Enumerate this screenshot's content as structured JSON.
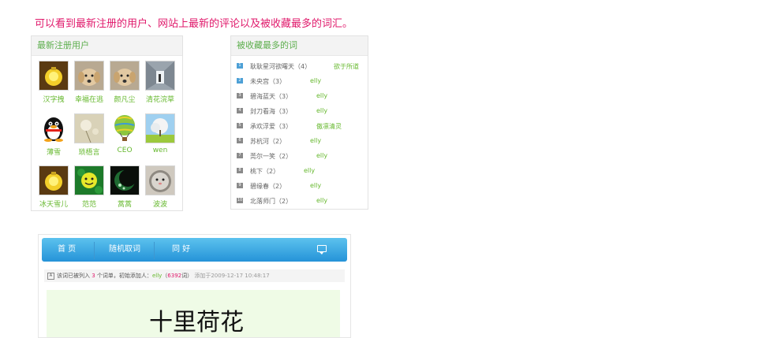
{
  "headline": "可以看到最新注册的用户、网站上最新的评论以及被收藏最多的词汇。",
  "users_panel": {
    "title": "最新注册用户",
    "users": [
      {
        "name": "汉字拽",
        "avatar": "glowing-ball-icon"
      },
      {
        "name": "幸福在逃",
        "avatar": "puppy-icon"
      },
      {
        "name": "颜凡尘",
        "avatar": "puppy-icon"
      },
      {
        "name": "清花浣草",
        "avatar": "corridor-icon"
      },
      {
        "name": "薄雪",
        "avatar": "penguin-icon"
      },
      {
        "name": "琐梧言",
        "avatar": "dandelion-icon"
      },
      {
        "name": "CEO",
        "avatar": "balloon-icon"
      },
      {
        "name": "wen",
        "avatar": "tree-icon"
      },
      {
        "name": "冰天雪儿",
        "avatar": "glowing-ball-icon"
      },
      {
        "name": "范范",
        "avatar": "smiley-icon"
      },
      {
        "name": "蒿蒿",
        "avatar": "moon-icon"
      },
      {
        "name": "波波",
        "avatar": "cat-icon"
      }
    ]
  },
  "words_panel": {
    "title": "被收藏最多的词",
    "words": [
      {
        "rank": "1",
        "word": "耿耿星河欲曙天（4）",
        "user": "欲于所道"
      },
      {
        "rank": "2",
        "word": "未央宫（3）",
        "user": "elly"
      },
      {
        "rank": "3",
        "word": "碧海蓝天（3）",
        "user": "elly"
      },
      {
        "rank": "4",
        "word": "封刀看海（3）",
        "user": "elly"
      },
      {
        "rank": "5",
        "word": "承欢浮爱（3）",
        "user": "傲凛清灵"
      },
      {
        "rank": "6",
        "word": "苏杭河（2）",
        "user": "elly"
      },
      {
        "rank": "7",
        "word": "莞尔一笑（2）",
        "user": "elly"
      },
      {
        "rank": "8",
        "word": "桃下（2）",
        "user": "elly"
      },
      {
        "rank": "9",
        "word": "碧缘春（2）",
        "user": "elly"
      },
      {
        "rank": "10",
        "word": "北落师门（2）",
        "user": "elly"
      }
    ]
  },
  "preview": {
    "nav": [
      "首 页",
      "随机取词",
      "同 好"
    ],
    "chat_icon": "chat-icon",
    "info_icon_glyph": "A",
    "info": {
      "prefix": "该词已被列入 ",
      "count": "3",
      "middle": " 个词单，初始添加人：",
      "adder": "elly",
      "open": "（",
      "adder_count": "6392",
      "close": "词）",
      "added": "添加于2009-12-17 10:48:17"
    },
    "big_word": "十里荷花"
  }
}
